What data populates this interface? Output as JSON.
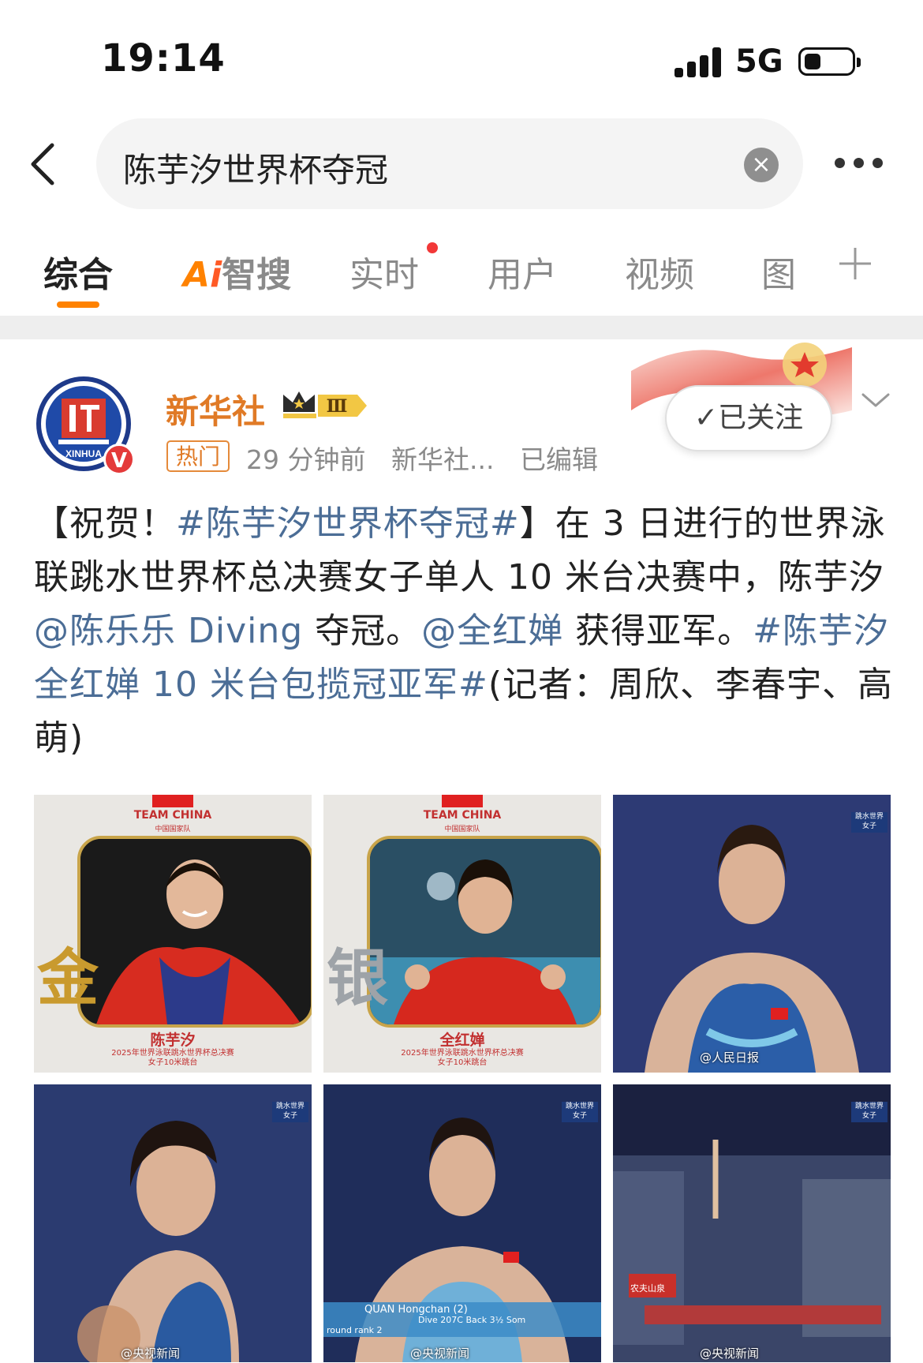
{
  "status": {
    "time": "19:14",
    "network": "5G"
  },
  "search": {
    "query": "陈芋汐世界杯夺冠",
    "clear": "×"
  },
  "tabs": {
    "items": [
      "综合",
      "实时",
      "用户",
      "视频",
      "图"
    ],
    "ai_a": "A",
    "ai_i": "i",
    "ai_text": "智搜",
    "active": "综合"
  },
  "post": {
    "author": "新华社",
    "level": "Ⅲ",
    "avatar_badge": "V",
    "hot_tag": "热门",
    "time": "29 分钟前",
    "source": "新华社...",
    "edited": "已编辑",
    "follow_label": "✓已关注",
    "text": {
      "p1": "【祝贺！",
      "tag1": "#陈芋汐世界杯夺冠#",
      "p2": "】在 3 日进行的世界泳联跳水世界杯总决赛女子单人 10 米台决赛中，陈芋汐",
      "mention1": "@陈乐乐 Diving",
      "p3": " 夺冠。",
      "mention2": "@全红婵",
      "p4": " 获得亚军。",
      "tag2": "#陈芋汐全红婵 10 米台包揽冠亚军#",
      "p5": "(记者：周欣、李春宇、高萌)"
    },
    "images": {
      "card1": {
        "team": "TEAM CHINA",
        "team_cn": "中国国家队",
        "medal": "金",
        "name": "陈芋汐",
        "desc1": "2025年世界泳联跳水世界杯总决赛",
        "desc2": "女子10米跳台"
      },
      "card2": {
        "team": "TEAM CHINA",
        "team_cn": "中国国家队",
        "medal": "银",
        "name": "全红婵",
        "desc1": "2025年世界泳联跳水世界杯总决赛",
        "desc2": "女子10米跳台"
      },
      "photo3": {
        "watermark": "@人民日报",
        "tv": "跳水世界 女子"
      },
      "photo4": {
        "watermark": "@央视新闻",
        "tv": "跳水世界 女子"
      },
      "photo5": {
        "watermark": "@央视新闻",
        "tv": "跳水世界 女子",
        "score_name": "QUAN Hongchan (2)",
        "score_dive": "Dive 207C   Back 3½ Som",
        "score_rank": "round rank 2"
      },
      "photo6": {
        "watermark": "@央视新闻",
        "tv": "跳水世界 女子",
        "sign": "农夫山泉"
      }
    }
  },
  "colors": {
    "accent": "#ff8200",
    "link": "#4b6d96",
    "author": "#e07a26"
  }
}
